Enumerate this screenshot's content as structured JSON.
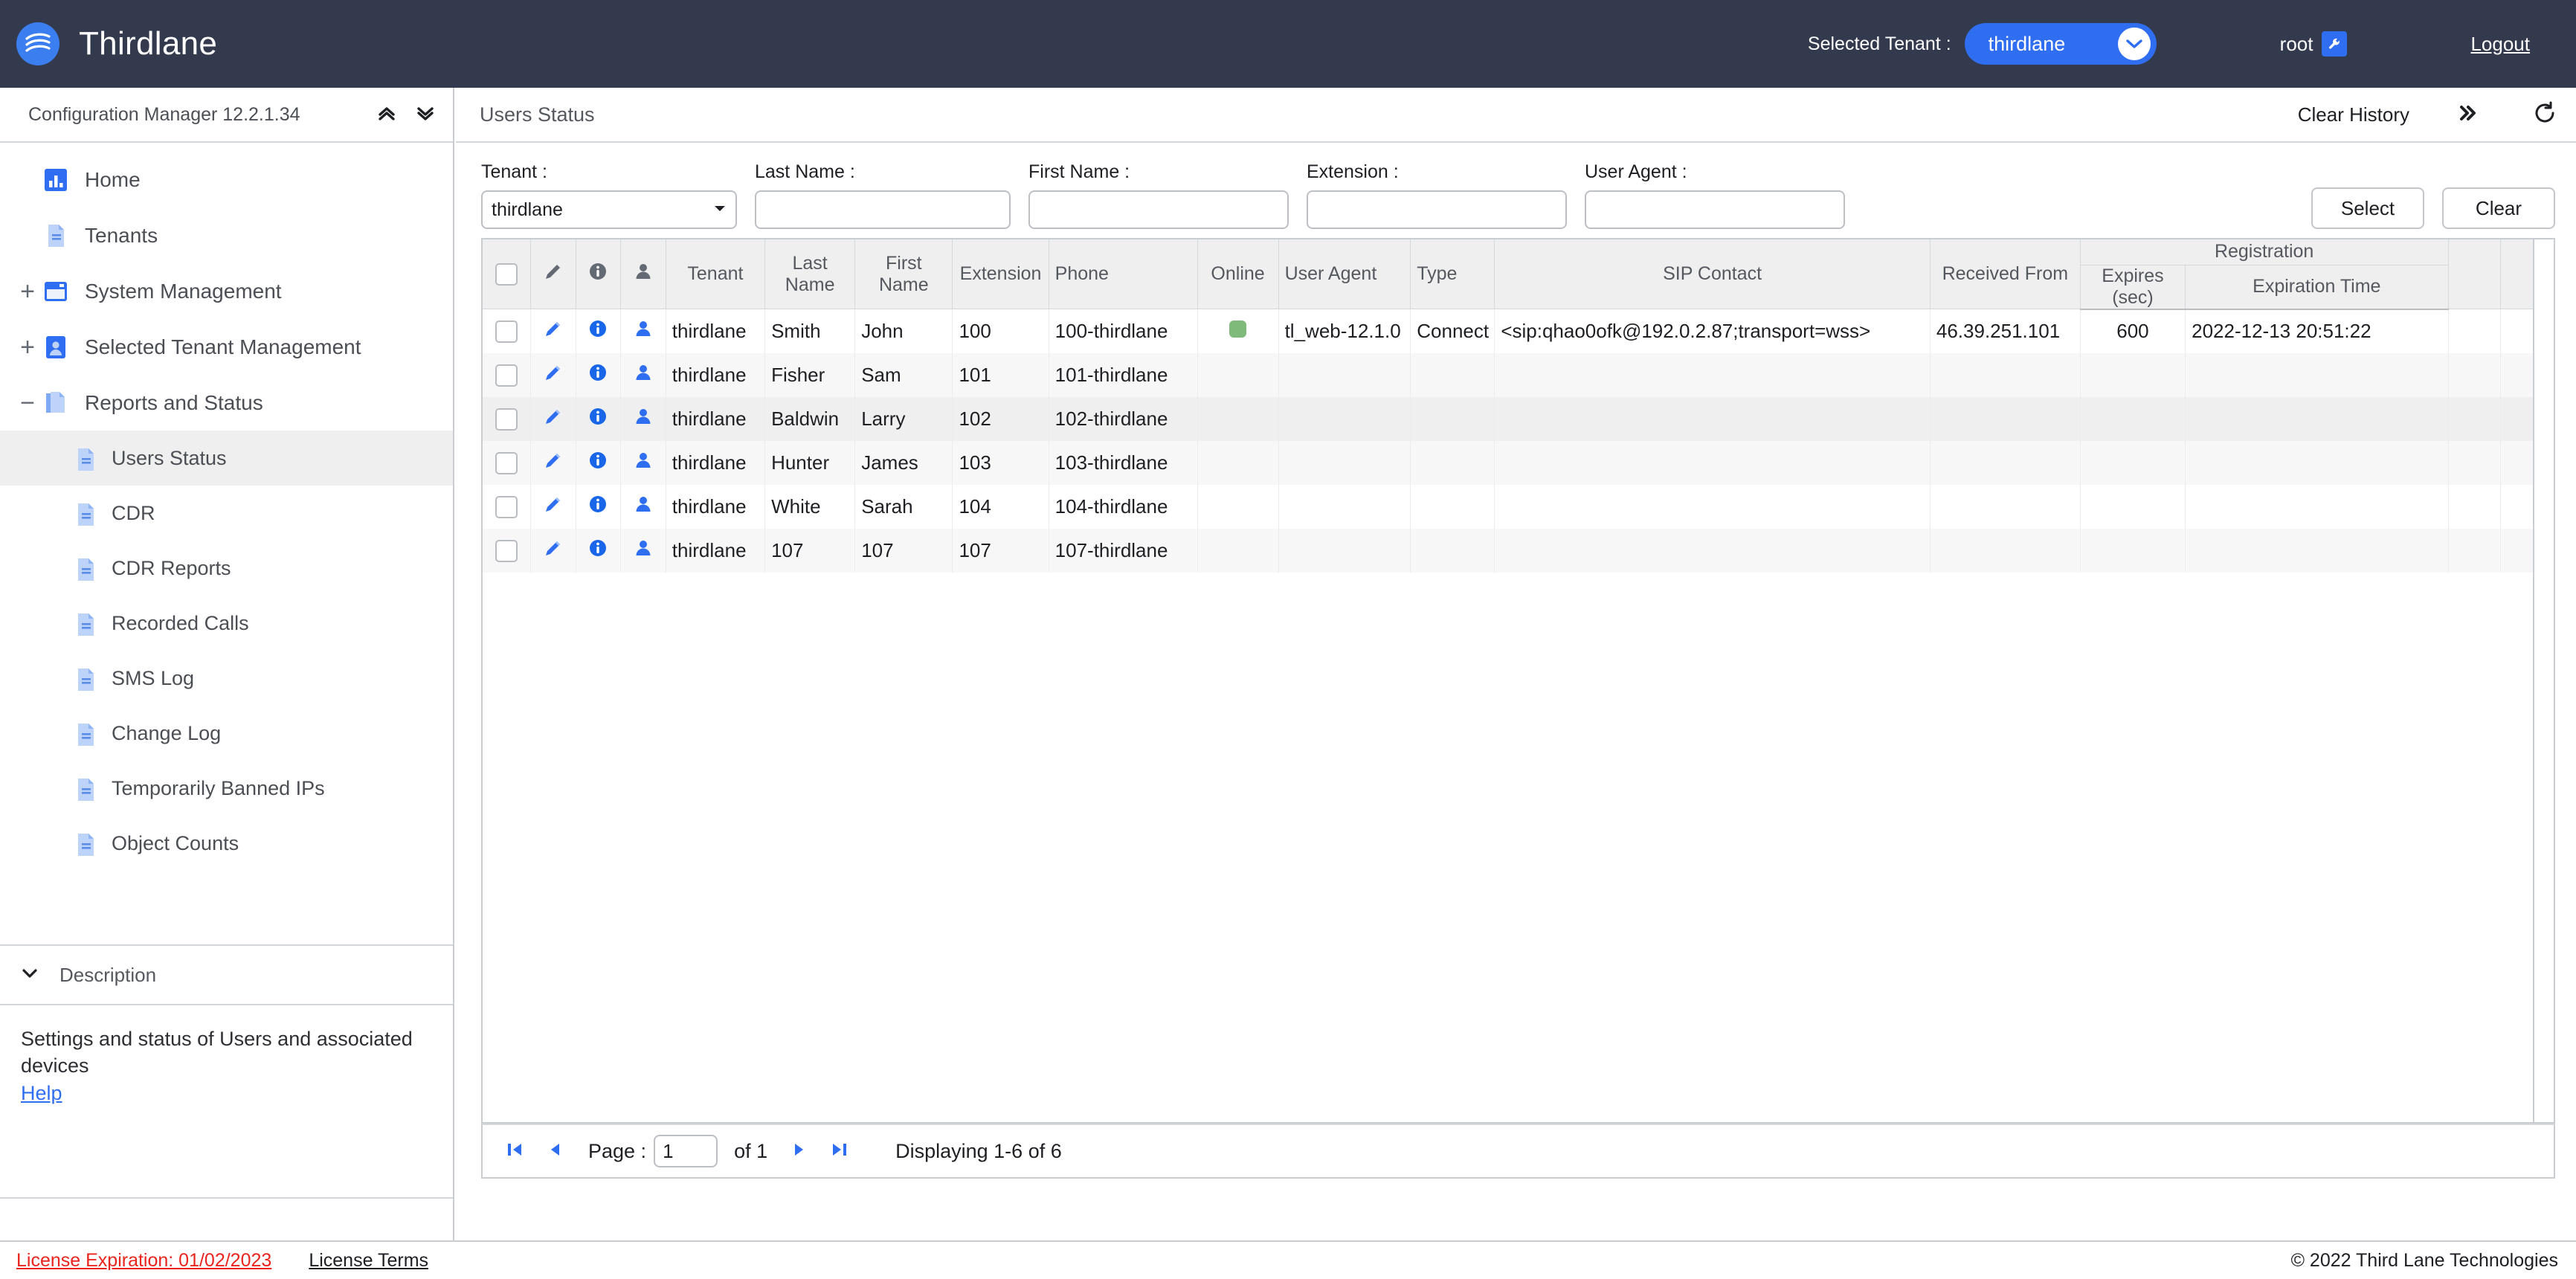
{
  "topbar": {
    "brand": "Thirdlane",
    "logo_icon": "thirdlane-waves-logo-icon",
    "selected_tenant_label": "Selected Tenant :",
    "selected_tenant_value": "thirdlane",
    "tenant_chevron_icon": "chevron-down-icon",
    "user_name": "root",
    "user_badge_icon": "wrench-icon",
    "logout_label": "Logout",
    "bg_color": "#333a4d",
    "accent_color": "#2f6ef0"
  },
  "sidebar": {
    "header_title": "Configuration Manager 12.2.1.34",
    "collapse_all_icon": "chevron-double-up-icon",
    "expand_all_icon": "chevron-double-down-icon",
    "items": [
      {
        "label": "Home",
        "icon": "chart-bar-icon",
        "expander": "",
        "level": 0,
        "selected": false
      },
      {
        "label": "Tenants",
        "icon": "document-icon",
        "expander": "",
        "level": 0,
        "selected": false
      },
      {
        "label": "System Management",
        "icon": "window-icon",
        "expander": "+",
        "level": 0,
        "selected": false
      },
      {
        "label": "Selected Tenant Management",
        "icon": "user-card-icon",
        "expander": "+",
        "level": 0,
        "selected": false
      },
      {
        "label": "Reports and Status",
        "icon": "documents-icon",
        "expander": "−",
        "level": 0,
        "selected": false
      },
      {
        "label": "Users Status",
        "icon": "document-icon",
        "expander": "",
        "level": 1,
        "selected": true
      },
      {
        "label": "CDR",
        "icon": "document-icon",
        "expander": "",
        "level": 1,
        "selected": false
      },
      {
        "label": "CDR Reports",
        "icon": "document-icon",
        "expander": "",
        "level": 1,
        "selected": false
      },
      {
        "label": "Recorded Calls",
        "icon": "document-icon",
        "expander": "",
        "level": 1,
        "selected": false
      },
      {
        "label": "SMS Log",
        "icon": "document-icon",
        "expander": "",
        "level": 1,
        "selected": false
      },
      {
        "label": "Change Log",
        "icon": "document-icon",
        "expander": "",
        "level": 1,
        "selected": false
      },
      {
        "label": "Temporarily Banned IPs",
        "icon": "document-icon",
        "expander": "",
        "level": 1,
        "selected": false
      },
      {
        "label": "Object Counts",
        "icon": "document-icon",
        "expander": "",
        "level": 1,
        "selected": false
      }
    ],
    "description": {
      "title": "Description",
      "toggle_icon": "chevron-down-icon",
      "text": "Settings and status of Users and associated devices",
      "help_label": "Help"
    }
  },
  "main": {
    "title": "Users Status",
    "clear_history_label": "Clear History",
    "expand_icon": "chevron-double-right-icon",
    "refresh_icon": "refresh-icon",
    "filters": [
      {
        "label": "Tenant :",
        "type": "select",
        "value": "thirdlane",
        "placeholder": ""
      },
      {
        "label": "Last Name :",
        "type": "text",
        "value": "",
        "placeholder": ""
      },
      {
        "label": "First Name :",
        "type": "text",
        "value": "",
        "placeholder": ""
      },
      {
        "label": "Extension :",
        "type": "text",
        "value": "",
        "placeholder": ""
      },
      {
        "label": "User Agent :",
        "type": "text",
        "value": "",
        "placeholder": ""
      }
    ],
    "select_button": "Select",
    "clear_button": "Clear"
  },
  "table": {
    "group_header": "Registration",
    "columns": [
      {
        "key": "check",
        "label": "",
        "icon": "checkbox-icon"
      },
      {
        "key": "edit",
        "label": "",
        "icon": "pencil-icon"
      },
      {
        "key": "info",
        "label": "",
        "icon": "info-circle-icon"
      },
      {
        "key": "user",
        "label": "",
        "icon": "person-icon"
      },
      {
        "key": "tenant",
        "label": "Tenant"
      },
      {
        "key": "last_name",
        "label": "Last Name"
      },
      {
        "key": "first_name",
        "label": "First Name"
      },
      {
        "key": "extension",
        "label": "Extension"
      },
      {
        "key": "phone",
        "label": "Phone"
      },
      {
        "key": "online",
        "label": "Online"
      },
      {
        "key": "user_agent",
        "label": "User Agent"
      },
      {
        "key": "type",
        "label": "Type"
      },
      {
        "key": "sip_contact",
        "label": "SIP Contact"
      },
      {
        "key": "received_from",
        "label": "Received From"
      },
      {
        "key": "expires",
        "label": "Expires (sec)"
      },
      {
        "key": "expiration_time",
        "label": "Expiration Time"
      },
      {
        "key": "extra1",
        "label": ""
      },
      {
        "key": "extra2",
        "label": ""
      }
    ],
    "rows": [
      {
        "tenant": "thirdlane",
        "last_name": "Smith",
        "first_name": "John",
        "extension": "100",
        "phone": "100-thirdlane",
        "online": true,
        "user_agent": "tl_web-12.1.0",
        "type": "Connect",
        "sip_contact": "<sip:qhao0ofk@192.0.2.87;transport=wss>",
        "received_from": "46.39.251.101",
        "expires": "600",
        "expiration_time": "2022-12-13 20:51:22"
      },
      {
        "tenant": "thirdlane",
        "last_name": "Fisher",
        "first_name": "Sam",
        "extension": "101",
        "phone": "101-thirdlane",
        "online": false,
        "user_agent": "",
        "type": "",
        "sip_contact": "",
        "received_from": "",
        "expires": "",
        "expiration_time": ""
      },
      {
        "tenant": "thirdlane",
        "last_name": "Baldwin",
        "first_name": "Larry",
        "extension": "102",
        "phone": "102-thirdlane",
        "online": false,
        "user_agent": "",
        "type": "",
        "sip_contact": "",
        "received_from": "",
        "expires": "",
        "expiration_time": ""
      },
      {
        "tenant": "thirdlane",
        "last_name": "Hunter",
        "first_name": "James",
        "extension": "103",
        "phone": "103-thirdlane",
        "online": false,
        "user_agent": "",
        "type": "",
        "sip_contact": "",
        "received_from": "",
        "expires": "",
        "expiration_time": ""
      },
      {
        "tenant": "thirdlane",
        "last_name": "White",
        "first_name": "Sarah",
        "extension": "104",
        "phone": "104-thirdlane",
        "online": false,
        "user_agent": "",
        "type": "",
        "sip_contact": "",
        "received_from": "",
        "expires": "",
        "expiration_time": ""
      },
      {
        "tenant": "thirdlane",
        "last_name": "107",
        "first_name": "107",
        "extension": "107",
        "phone": "107-thirdlane",
        "online": false,
        "user_agent": "",
        "type": "",
        "sip_contact": "",
        "received_from": "",
        "expires": "",
        "expiration_time": ""
      }
    ]
  },
  "pager": {
    "first_icon": "first-page-icon",
    "prev_icon": "prev-page-icon",
    "next_icon": "next-page-icon",
    "last_icon": "last-page-icon",
    "page_label": "Page :",
    "page_value": "1",
    "of_label": "of  1",
    "displaying": "Displaying 1-6 of 6"
  },
  "footer": {
    "license_expiration": "License Expiration: 01/02/2023",
    "license_terms": "License Terms",
    "copyright": "© 2022 Third Lane Technologies",
    "expiration_color": "#e8241c"
  }
}
